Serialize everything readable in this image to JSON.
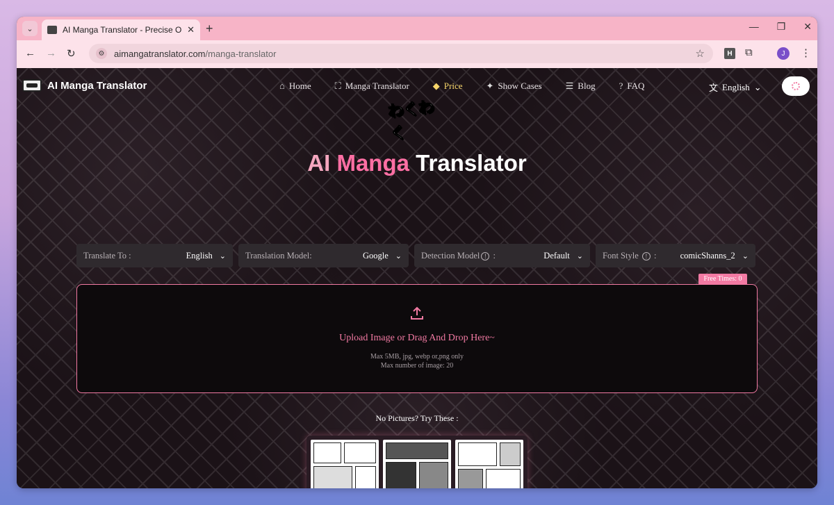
{
  "browser": {
    "tab_title": "AI Manga Translator - Precise O",
    "url_host": "aimangatranslator.com",
    "url_path": "/manga-translator",
    "ext_h_label": "H",
    "avatar_initial": "J"
  },
  "site": {
    "logo_text": "AI Manga Translator",
    "nav": [
      {
        "label": "Home",
        "icon": "home-icon"
      },
      {
        "label": "Manga Translator",
        "icon": "scan-icon"
      },
      {
        "label": "Price",
        "icon": "diamond-icon",
        "active": true
      },
      {
        "label": "Show Cases",
        "icon": "sparkle-icon"
      },
      {
        "label": "Blog",
        "icon": "blog-icon"
      },
      {
        "label": "FAQ",
        "icon": "help-icon"
      }
    ],
    "language": "English"
  },
  "hero": {
    "badge_text": "わくわく",
    "title_part1": "AI ",
    "title_part2": "Manga",
    "title_part3": " Translator"
  },
  "options": {
    "translate_to": {
      "label": "Translate To :",
      "value": "English"
    },
    "translation_model": {
      "label": "Translation Model:",
      "value": "Google"
    },
    "detection_model": {
      "label": "Detection Model",
      "suffix": " :",
      "value": "Default"
    },
    "font_style": {
      "label": "Font Style",
      "suffix": " :",
      "value": "comicShanns_2"
    }
  },
  "free_times": "Free Times: 0",
  "upload": {
    "text": "Upload Image or Drag And Drop Here~",
    "hint1": "Max 5MB, jpg, webp or,png only",
    "hint2": "Max number of image: 20"
  },
  "samples": {
    "title": "No Pictures? Try These :"
  },
  "colors": {
    "accent": "#f27aa3",
    "price_gold": "#f6d56a",
    "tabstrip": "#f7b4c7"
  }
}
